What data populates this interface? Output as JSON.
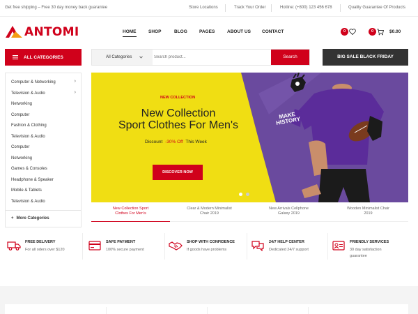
{
  "topbar": {
    "left": "Get free shipping – Free 30 day money back guarantee",
    "store_locations": "Store Locations",
    "track_order": "Track Your Order",
    "hotline": "Hotline: (+800) 123 456 678",
    "quality": "Quality Guarantee Of Products"
  },
  "brand": {
    "name": "ANTOMI",
    "color": "#d0011b"
  },
  "nav": [
    "HOME",
    "SHOP",
    "BLOG",
    "PAGES",
    "ABOUT US",
    "CONTACT"
  ],
  "header": {
    "wishlist_count": "0",
    "cart_count": "0",
    "cart_total": "$0.00"
  },
  "categories_button": "ALL CATEGORIES",
  "search": {
    "category": "All Categories",
    "placeholder": "Search product...",
    "button": "Search"
  },
  "sale_button": "BIG SALE BLACK FRIDAY",
  "sidebar": {
    "items": [
      {
        "label": "Computer & Networking",
        "has_sub": true
      },
      {
        "label": "Television & Audio",
        "has_sub": true
      },
      {
        "label": "Networking",
        "has_sub": false
      },
      {
        "label": "Computer",
        "has_sub": false
      },
      {
        "label": "Fashion & Clothing",
        "has_sub": false
      },
      {
        "label": "Television & Audio",
        "has_sub": false
      },
      {
        "label": "Computer",
        "has_sub": false
      },
      {
        "label": "Networking",
        "has_sub": false
      },
      {
        "label": "Games & Consoles",
        "has_sub": false
      },
      {
        "label": "Headphone & Speaker",
        "has_sub": false
      },
      {
        "label": "Mobile & Tablets",
        "has_sub": false
      },
      {
        "label": "Television & Audio",
        "has_sub": false
      }
    ],
    "more": "More Categories"
  },
  "banner": {
    "tag": "NEW COLLECTION",
    "title_line1": "New Collection",
    "title_line2": "Sport Clothes For Men's",
    "discount_prefix": "Discount",
    "discount_value": "-30% Off",
    "discount_suffix": "This Week",
    "button": "DISCOVER NOW",
    "shirt_text": "MAKE HISTORY",
    "active_slide": 1,
    "slide_count": 2
  },
  "tabs": [
    {
      "line1": "New Collection Sport",
      "line2": "Clothes For Men's"
    },
    {
      "line1": "Clear & Modern Minimalist",
      "line2": "Chair 2019"
    },
    {
      "line1": "New Arrivals Cellphone",
      "line2": "Galaxy 2019"
    },
    {
      "line1": "Wooden Minimalist Chair",
      "line2": "2019"
    }
  ],
  "features": [
    {
      "icon": "truck-icon",
      "title": "FREE DELIVERY",
      "sub1": "For all oders over $120",
      "sub2": ""
    },
    {
      "icon": "credit-card-icon",
      "title": "SAFE PAYMENT",
      "sub1": "100% secure payment",
      "sub2": ""
    },
    {
      "icon": "handshake-icon",
      "title": "SHOP WITH CONFIDENCE",
      "sub1": "If goods have problems",
      "sub2": ""
    },
    {
      "icon": "chat-icon",
      "title": "24/7 HELP CENTER",
      "sub1": "Dedicated 24/7 support",
      "sub2": ""
    },
    {
      "icon": "id-card-icon",
      "title": "FRIENDLY SERVICES",
      "sub1": "30 day satisfaction",
      "sub2": "guarantee"
    }
  ]
}
